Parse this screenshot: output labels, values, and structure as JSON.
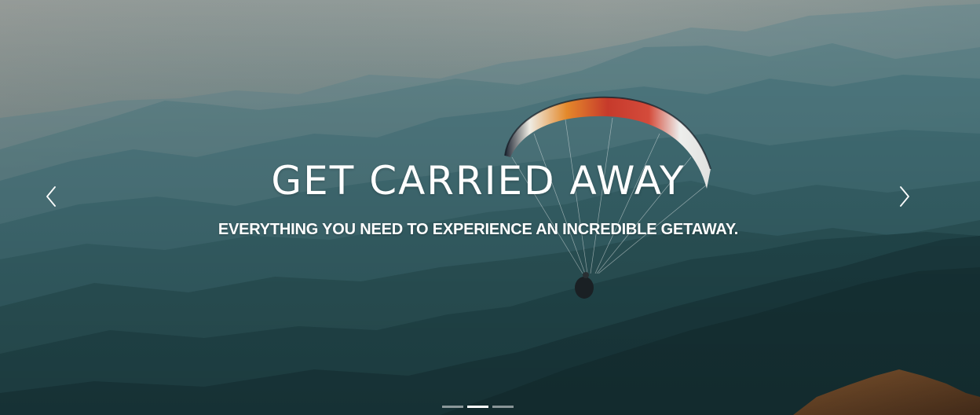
{
  "hero": {
    "title": "GET CARRIED AWAY",
    "subtitle": "EVERYTHING YOU NEED TO EXPERIENCE AN INCREDIBLE GETAWAY."
  },
  "carousel": {
    "prev_icon": "chevron-left-icon",
    "next_icon": "chevron-right-icon",
    "slide_count": 3,
    "active_slide": 2
  },
  "colors": {
    "text": "#ffffff",
    "sky": "#9fa6a2",
    "mountains_far": "#4e7c86",
    "mountains_near": "#1f4a4f"
  }
}
